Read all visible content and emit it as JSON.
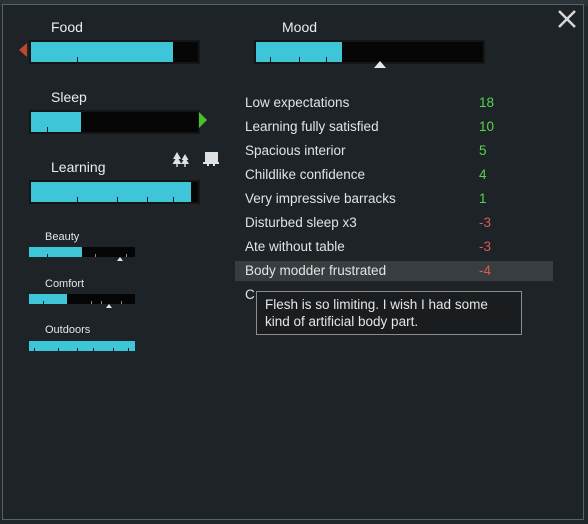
{
  "needs": {
    "food": {
      "label": "Food",
      "level": 0.85
    },
    "mood": {
      "label": "Mood",
      "level": 0.38,
      "threshold": 0.57
    },
    "sleep": {
      "label": "Sleep",
      "level": 0.3
    },
    "learning": {
      "label": "Learning",
      "level": 0.96
    }
  },
  "small_needs": [
    {
      "label": "Beauty",
      "level": 0.5,
      "threshold": 0.85
    },
    {
      "label": "Comfort",
      "level": 0.36,
      "threshold": 0.76
    },
    {
      "label": "Outdoors",
      "level": 1.0
    }
  ],
  "icons": {
    "close": "close-icon",
    "left_arrow": "decreasing-arrow-icon",
    "right_arrow": "increasing-arrow-icon",
    "trees": "trees-icon",
    "schedule": "schedule-icon"
  },
  "colors": {
    "bar_fill": "#3ec6d8",
    "positive": "#58d34e",
    "negative": "#d85b57",
    "decrease_arrow": "#c0472b",
    "increase_arrow": "#49c02b"
  },
  "thoughts": [
    {
      "label": "Low expectations",
      "value": "18",
      "sign": "pos"
    },
    {
      "label": "Learning fully satisfied",
      "value": "10",
      "sign": "pos"
    },
    {
      "label": "Spacious interior",
      "value": "5",
      "sign": "pos"
    },
    {
      "label": "Childlike confidence",
      "value": "4",
      "sign": "pos"
    },
    {
      "label": "Very impressive barracks",
      "value": "1",
      "sign": "pos"
    },
    {
      "label": "Disturbed sleep x3",
      "value": "-3",
      "sign": "neg"
    },
    {
      "label": "Ate without table",
      "value": "-3",
      "sign": "neg"
    },
    {
      "label": "Body modder frustrated",
      "value": "-4",
      "sign": "neg"
    },
    {
      "label": "C",
      "value": "",
      "sign": "neg"
    }
  ],
  "tooltip": {
    "text": "Flesh is so limiting. I wish I had some kind of artificial body part."
  }
}
